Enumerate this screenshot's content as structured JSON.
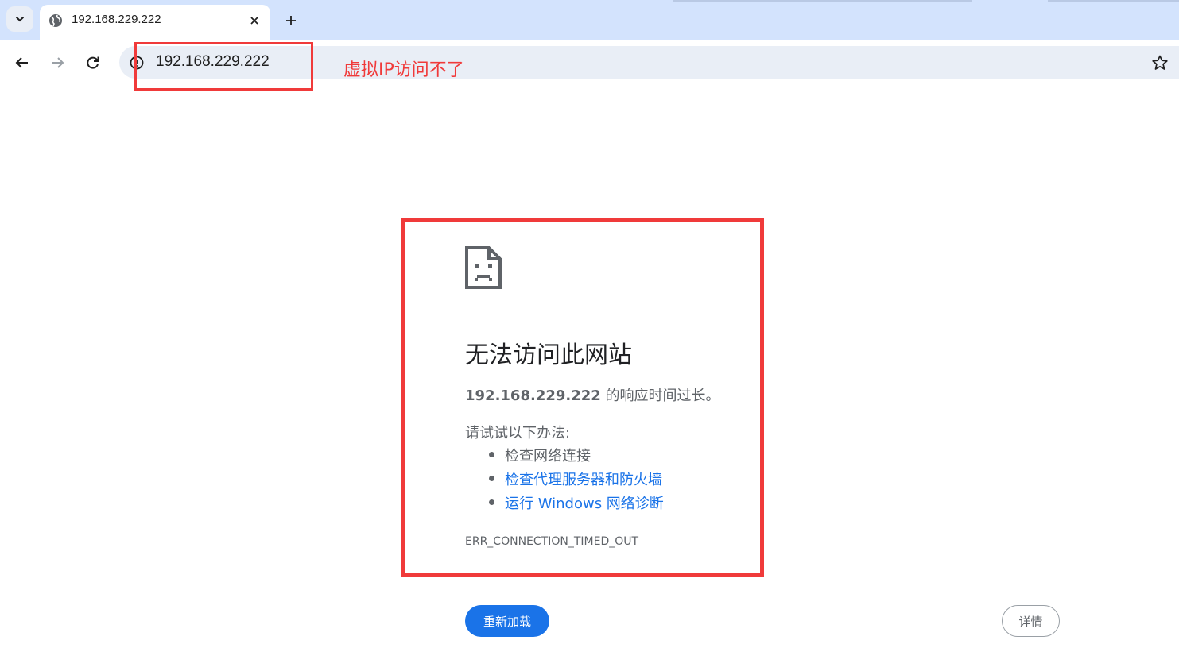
{
  "browser": {
    "tab": {
      "title": "192.168.229.222",
      "favicon": "globe-icon"
    },
    "icons": {
      "tab_search": "chevron-down-icon",
      "tab_close": "close-icon",
      "new_tab": "plus-icon",
      "back": "arrow-left-icon",
      "forward": "arrow-right-icon",
      "reload": "reload-icon",
      "site_info": "site-info-icon",
      "bookmark": "star-icon"
    },
    "omnibox": {
      "url": "192.168.229.222"
    }
  },
  "annotation": {
    "text": "虚拟IP访问不了",
    "color": "#f03a3a"
  },
  "error_page": {
    "icon": "sad-document-icon",
    "title": "无法访问此网站",
    "host": "192.168.229.222",
    "description_suffix": " 的响应时间过长。",
    "try_label": "请试试以下办法:",
    "suggestions": [
      {
        "text": "检查网络连接",
        "link": false
      },
      {
        "text": "检查代理服务器和防火墙",
        "link": true
      },
      {
        "text": "运行 Windows 网络诊断",
        "link": true
      }
    ],
    "error_code": "ERR_CONNECTION_TIMED_OUT",
    "reload_label": "重新加载",
    "details_label": "详情"
  },
  "colors": {
    "tabstrip_bg": "#d3e3fd",
    "omnibox_bg": "#e9eef6",
    "primary_button": "#1a73e8",
    "link": "#1a73e8",
    "annotation_red": "#f03a3a"
  }
}
